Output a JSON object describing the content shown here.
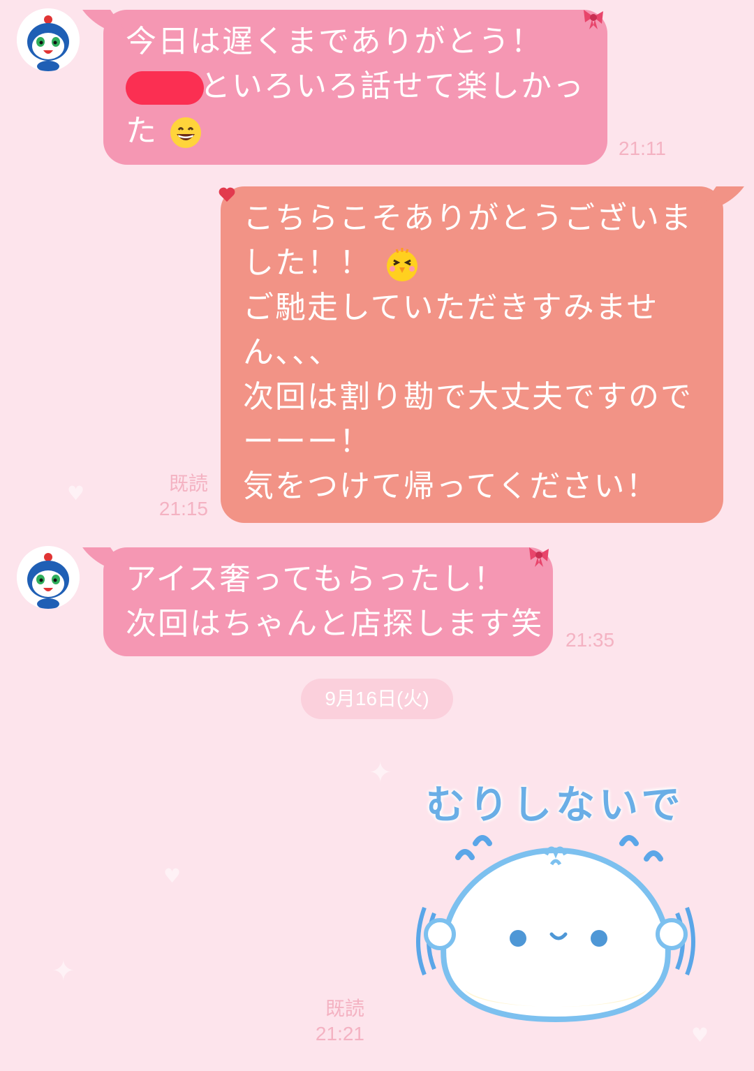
{
  "messages": [
    {
      "side": "left",
      "lines": [
        "今日は遅くまでありがとう！",
        "といろいろ話せて楽しかっ",
        "た"
      ],
      "time": "21:11"
    },
    {
      "side": "right",
      "lines": [
        "こちらこそありがとうございま",
        "した！！",
        "ご馳走していただきすみませ",
        "ん、、、",
        "次回は割り勘で大丈夫ですので",
        "ーーー！",
        "気をつけて帰ってください！"
      ],
      "read": "既読",
      "time": "21:15"
    },
    {
      "side": "left",
      "lines": [
        "アイス奢ってもらったし！",
        "次回はちゃんと店探します笑"
      ],
      "time": "21:35"
    }
  ],
  "date_separator": "9月16日(火)",
  "sticker": {
    "text": "むりしないで",
    "read": "既読",
    "time": "21:21"
  },
  "icons": {
    "avatar": "penguin-character-avatar",
    "grin": "grinning-emoji",
    "chick": "chick-emoji",
    "sticker": "dumpling-character-sticker",
    "ribbon": "ribbon-icon",
    "heart": "heart-icon"
  },
  "colors": {
    "background": "#fde4ec",
    "left_bubble": "#f597b3",
    "right_bubble": "#f29386",
    "redaction": "#fb2f52"
  }
}
